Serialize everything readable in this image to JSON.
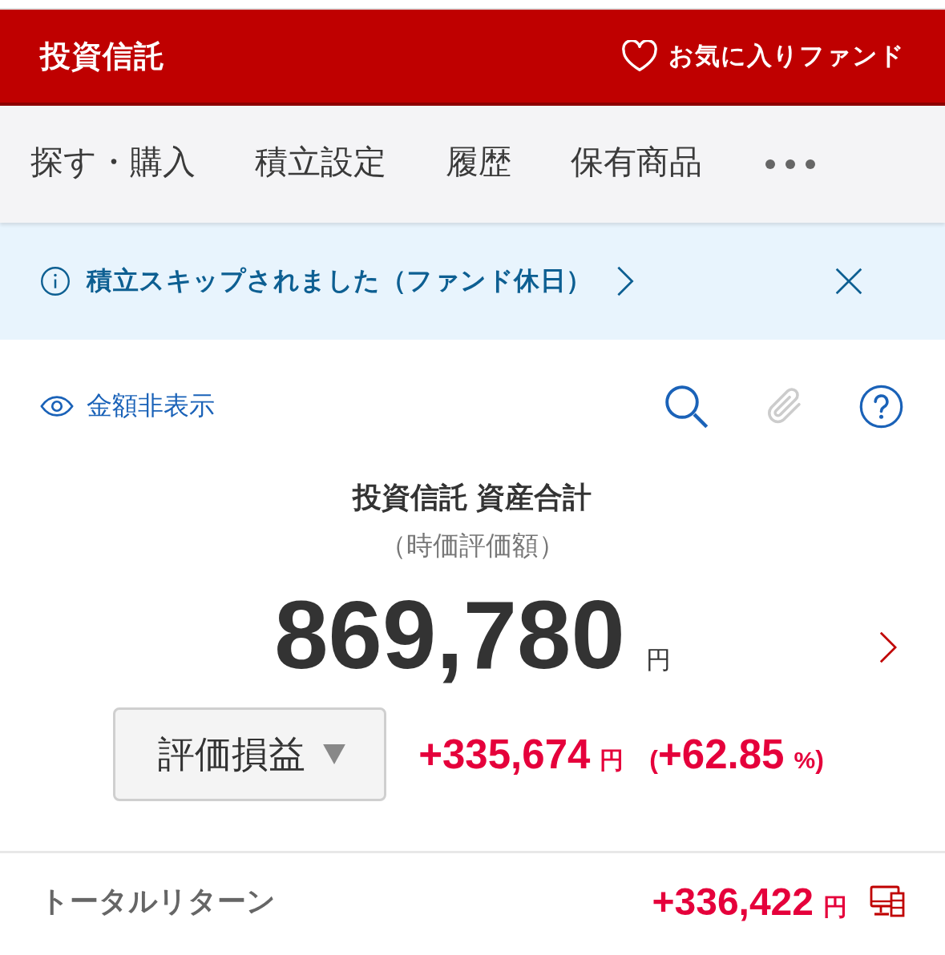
{
  "header": {
    "title": "投資信託",
    "favorites_link": "お気に入りファンド"
  },
  "tabs": [
    {
      "label": "探す・購入",
      "selected": false
    },
    {
      "label": "積立設定",
      "selected": false
    },
    {
      "label": "履歴",
      "selected": false
    },
    {
      "label": "保有商品",
      "selected": false
    }
  ],
  "notice": {
    "message": "積立スキップされました（ファンド休日）"
  },
  "toolbar": {
    "hide_amount_label": "金額非表示",
    "icons": [
      {
        "kind": "search",
        "disabled": false
      },
      {
        "kind": "attachment",
        "disabled": true
      },
      {
        "kind": "help",
        "disabled": false
      }
    ]
  },
  "summary": {
    "title": "投資信託 資産合計",
    "subtitle": "（時価評価額）",
    "amount": "869,780",
    "unit": "円"
  },
  "gain": {
    "selector": "評価損益",
    "value": "+335,674",
    "unit": "円",
    "rate_open": "(",
    "rate": "+62.85",
    "rate_unit": "%",
    "rate_close": ")"
  },
  "total_return": {
    "label": "トータルリターン",
    "value": "+336,422",
    "unit": "円"
  }
}
